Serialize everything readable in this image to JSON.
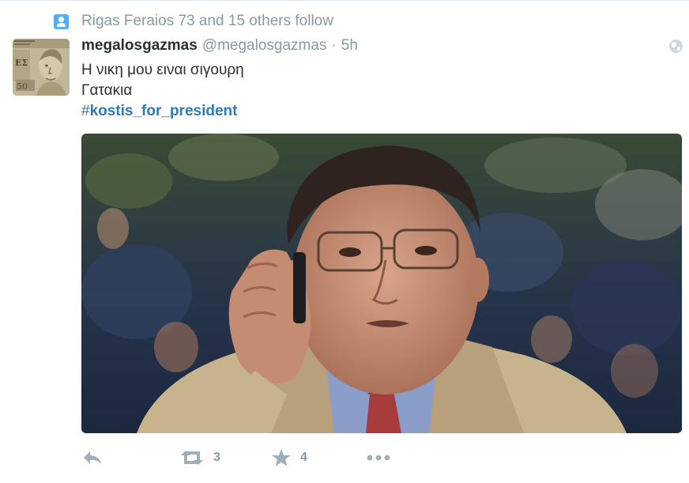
{
  "context": {
    "icon": "follow-person-icon",
    "text": "Rigas Feraios 73 and 15 others follow"
  },
  "tweet": {
    "fullname": "megalosgazmas",
    "username": "@megalosgazmas",
    "separator": "·",
    "time": "5h",
    "lines": [
      "Η νικη μου ειναι σιγουρη",
      "Γατακια"
    ],
    "hashtag_symbol": "#",
    "hashtag": "kostis_for_president"
  },
  "actions": {
    "retweet_count": "3",
    "favorite_count": "4"
  },
  "colors": {
    "link": "#2b7bb9",
    "muted": "#8899a6",
    "icon_muted": "#a0aeb8",
    "accent": "#55acee"
  }
}
